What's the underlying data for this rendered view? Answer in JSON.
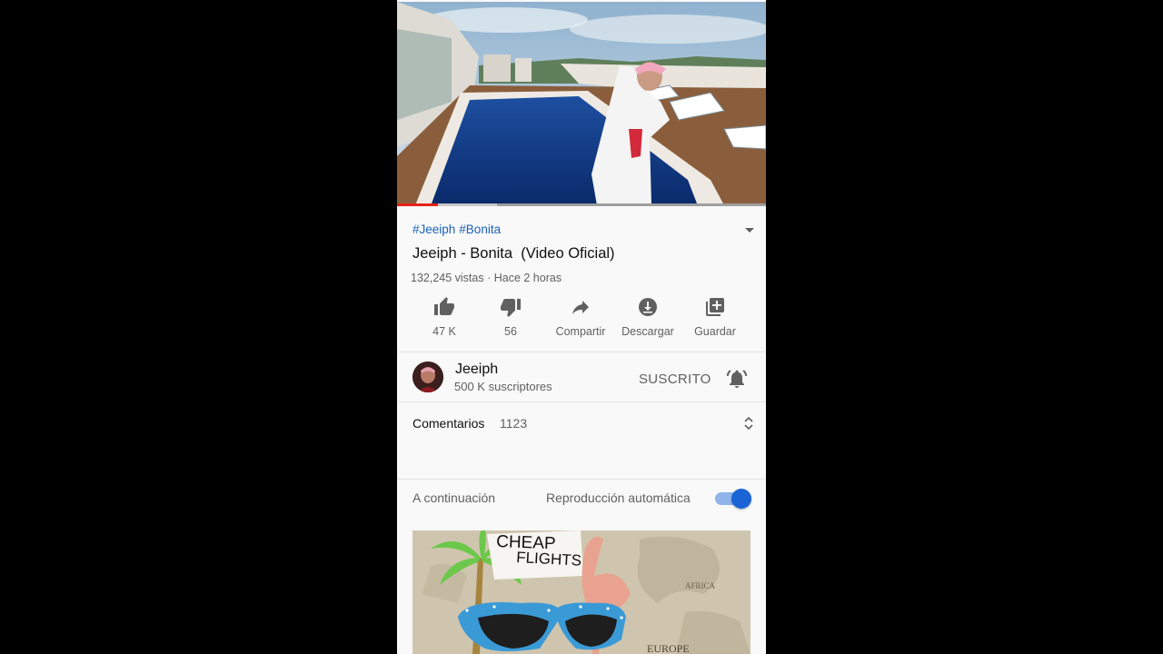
{
  "video": {
    "hashtags": [
      "#Jeeiph",
      "#Bonita"
    ],
    "title": "Jeeiph - Bonita  (Video Oficial)",
    "meta": "132,245 vistas · Hace 2 horas",
    "progress_played": 0.11,
    "progress_buffered": 0.27
  },
  "actions": {
    "like": "47 K",
    "dislike": "56",
    "share": "Compartir",
    "download": "Descargar",
    "save": "Guardar"
  },
  "channel": {
    "name": "Jeeiph",
    "subscribers": "500 K suscriptores",
    "subscribed_label": "SUSCRITO"
  },
  "comments": {
    "label": "Comentarios",
    "count": "1123"
  },
  "up_next": {
    "label": "A continuación",
    "autoplay_label": "Reproducción automática",
    "autoplay_on": true
  },
  "next_video": {
    "thumbnail_text_line1": "CHEAP",
    "thumbnail_text_line2": "FLIGHTS",
    "map_label_1": "AFRICA",
    "map_label_2": "EUROPE"
  },
  "colors": {
    "accent": "#1a64d6",
    "link": "#1c62b9",
    "progress": "#e62117"
  }
}
